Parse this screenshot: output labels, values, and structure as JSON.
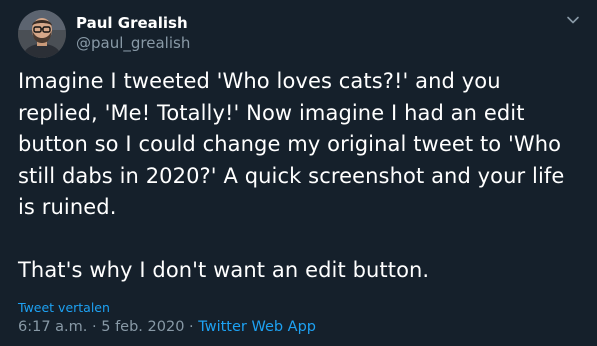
{
  "author": {
    "display_name": "Paul Grealish",
    "handle": "@paul_grealish",
    "avatar_icon": "avatar-photo"
  },
  "tweet": {
    "text": "Imagine I tweeted 'Who loves cats?!' and you replied, 'Me! Totally!' Now imagine I had an edit button so I could change my original tweet to 'Who still dabs in 2020?' A quick screenshot and your life is ruined.\n\nThat's why I don't want an edit button."
  },
  "actions": {
    "translate_label": "Tweet vertalen",
    "caret_icon": "chevron-down-icon"
  },
  "meta": {
    "time": "6:17 a.m.",
    "separator1": " · ",
    "date": "5 feb. 2020",
    "separator2": " · ",
    "source": "Twitter Web App"
  },
  "colors": {
    "background": "#15202b",
    "text": "#ffffff",
    "secondary": "#8899a6",
    "accent": "#1da1f2"
  }
}
